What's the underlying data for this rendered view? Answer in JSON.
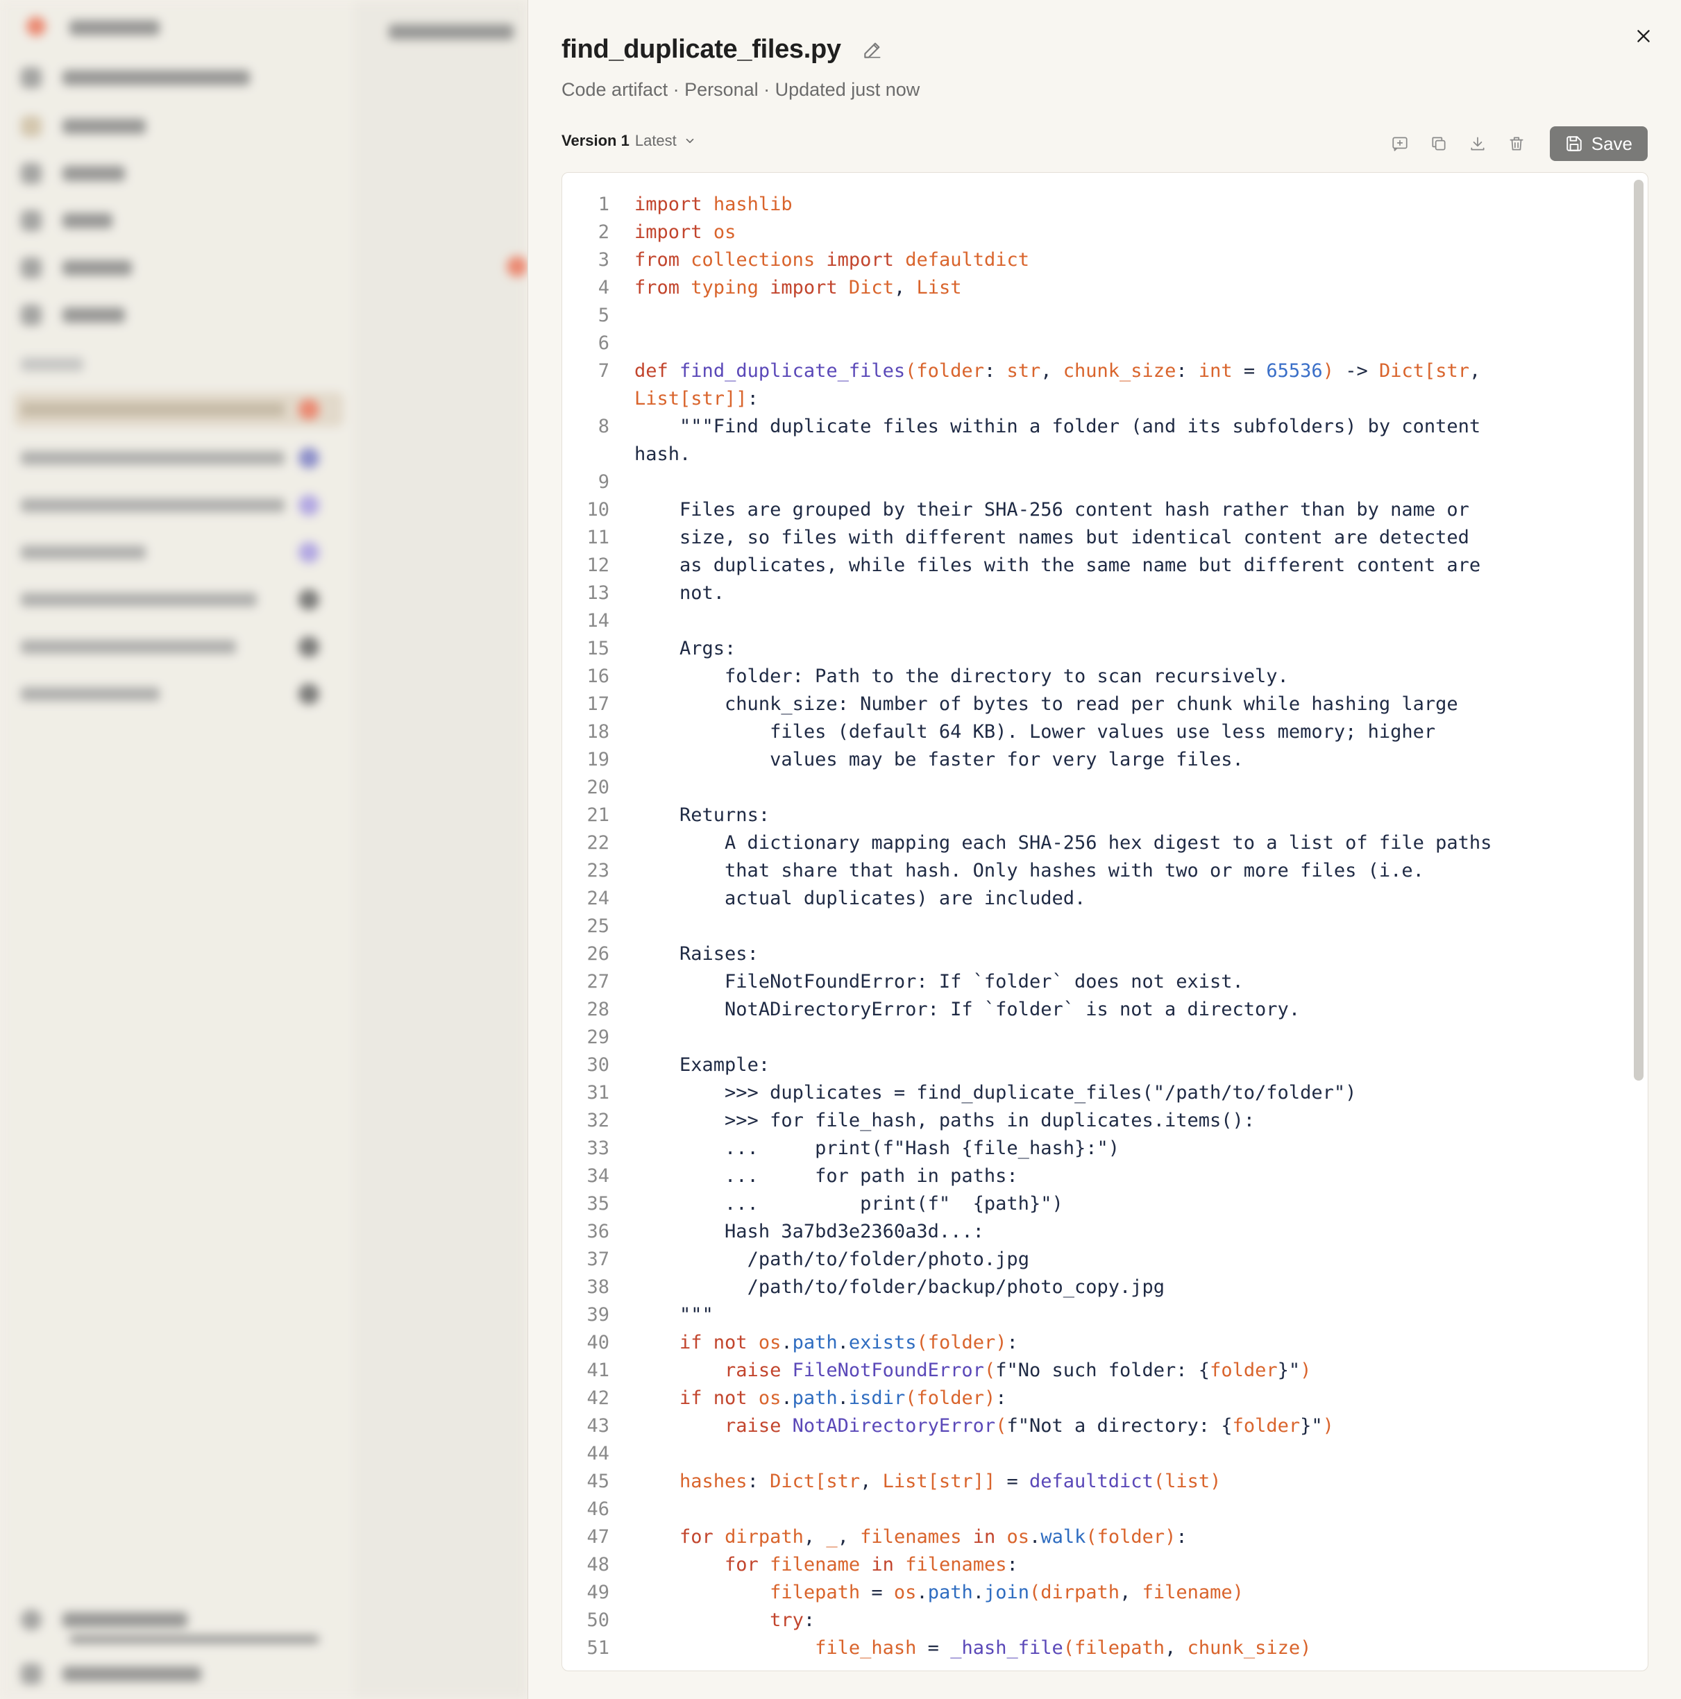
{
  "artifact": {
    "title": "find_duplicate_files.py",
    "subtitle": "Code artifact · Personal · Updated just now",
    "version_name": "Version 1",
    "version_tag": "Latest",
    "save_label": "Save"
  },
  "icons": {
    "edit": "pencil-icon",
    "close": "close-icon",
    "chevron": "chevron-down-icon",
    "comment": "add-comment-icon",
    "copy": "copy-icon",
    "download": "download-icon",
    "delete": "trash-icon",
    "save": "floppy-disk-icon"
  },
  "colors": {
    "keyword": "#c2452d",
    "identifier": "#d9642c",
    "function": "#5a48b8",
    "number": "#3a6fc8",
    "save_button": "#7a7a78"
  },
  "code_lines": [
    {
      "n": "1",
      "t": "<span class=\"kw\">import</span> <span class=\"id\">hashlib</span>"
    },
    {
      "n": "2",
      "t": "<span class=\"kw\">import</span> <span class=\"id\">os</span>"
    },
    {
      "n": "3",
      "t": "<span class=\"kw\">from</span> <span class=\"id\">collections</span> <span class=\"kw\">import</span> <span class=\"id\">defaultdict</span>"
    },
    {
      "n": "4",
      "t": "<span class=\"kw\">from</span> <span class=\"id\">typing</span> <span class=\"kw\">import</span> <span class=\"id\">Dict</span>, <span class=\"id\">List</span>"
    },
    {
      "n": "5",
      "t": ""
    },
    {
      "n": "6",
      "t": ""
    },
    {
      "n": "7",
      "t": "<span class=\"kw\">def</span> <span class=\"fn\">find_duplicate_files</span><span class=\"id\">(folder</span>: <span class=\"id\">str</span>, <span class=\"id\">chunk_size</span>: <span class=\"id\">int</span> = <span class=\"num\">65536</span><span class=\"id\">)</span> -&gt; <span class=\"id\">Dict[str</span>,\n<span class=\"id\">List[str]]</span>:"
    },
    {
      "n": "8",
      "t": "    \"\"\"Find duplicate files within a folder (and its subfolders) by content\nhash."
    },
    {
      "n": "9",
      "t": ""
    },
    {
      "n": "10",
      "t": "    Files are grouped by their SHA-256 content hash rather than by name or"
    },
    {
      "n": "11",
      "t": "    size, so files with different names but identical content are detected"
    },
    {
      "n": "12",
      "t": "    as duplicates, while files with the same name but different content are"
    },
    {
      "n": "13",
      "t": "    not."
    },
    {
      "n": "14",
      "t": ""
    },
    {
      "n": "15",
      "t": "    Args:"
    },
    {
      "n": "16",
      "t": "        folder: Path to the directory to scan recursively."
    },
    {
      "n": "17",
      "t": "        chunk_size: Number of bytes to read per chunk while hashing large"
    },
    {
      "n": "18",
      "t": "            files (default 64 KB). Lower values use less memory; higher"
    },
    {
      "n": "19",
      "t": "            values may be faster for very large files."
    },
    {
      "n": "20",
      "t": ""
    },
    {
      "n": "21",
      "t": "    Returns:"
    },
    {
      "n": "22",
      "t": "        A dictionary mapping each SHA-256 hex digest to a list of file paths"
    },
    {
      "n": "23",
      "t": "        that share that hash. Only hashes with two or more files (i.e."
    },
    {
      "n": "24",
      "t": "        actual duplicates) are included."
    },
    {
      "n": "25",
      "t": ""
    },
    {
      "n": "26",
      "t": "    Raises:"
    },
    {
      "n": "27",
      "t": "        FileNotFoundError: If `folder` does not exist."
    },
    {
      "n": "28",
      "t": "        NotADirectoryError: If `folder` is not a directory."
    },
    {
      "n": "29",
      "t": ""
    },
    {
      "n": "30",
      "t": "    Example:"
    },
    {
      "n": "31",
      "t": "        &gt;&gt;&gt; duplicates = find_duplicate_files(\"/path/to/folder\")"
    },
    {
      "n": "32",
      "t": "        &gt;&gt;&gt; for file_hash, paths in duplicates.items():"
    },
    {
      "n": "33",
      "t": "        ...     print(f\"Hash {file_hash}:\")"
    },
    {
      "n": "34",
      "t": "        ...     for path in paths:"
    },
    {
      "n": "35",
      "t": "        ...         print(f\"  {path}\")"
    },
    {
      "n": "36",
      "t": "        Hash 3a7bd3e2360a3d...:"
    },
    {
      "n": "37",
      "t": "          /path/to/folder/photo.jpg"
    },
    {
      "n": "38",
      "t": "          /path/to/folder/backup/photo_copy.jpg"
    },
    {
      "n": "39",
      "t": "    \"\"\""
    },
    {
      "n": "40",
      "t": "    <span class=\"kw\">if not</span> <span class=\"id\">os</span>.<span class=\"at\">path</span>.<span class=\"at\">exists</span><span class=\"id\">(folder)</span>:"
    },
    {
      "n": "41",
      "t": "        <span class=\"kw\">raise</span> <span class=\"fn\">FileNotFoundError</span><span class=\"id\">(</span>f\"No such folder: {<span class=\"id\">folder</span>}\"<span class=\"id\">)</span>"
    },
    {
      "n": "42",
      "t": "    <span class=\"kw\">if not</span> <span class=\"id\">os</span>.<span class=\"at\">path</span>.<span class=\"at\">isdir</span><span class=\"id\">(folder)</span>:"
    },
    {
      "n": "43",
      "t": "        <span class=\"kw\">raise</span> <span class=\"fn\">NotADirectoryError</span><span class=\"id\">(</span>f\"Not a directory: {<span class=\"id\">folder</span>}\"<span class=\"id\">)</span>"
    },
    {
      "n": "44",
      "t": ""
    },
    {
      "n": "45",
      "t": "    <span class=\"id\">hashes</span>: <span class=\"id\">Dict[str</span>, <span class=\"id\">List[str]]</span> = <span class=\"fn\">defaultdict</span><span class=\"id\">(list)</span>"
    },
    {
      "n": "46",
      "t": ""
    },
    {
      "n": "47",
      "t": "    <span class=\"kw\">for</span> <span class=\"id\">dirpath</span>, <span class=\"id\">_</span>, <span class=\"id\">filenames</span> <span class=\"kw\">in</span> <span class=\"id\">os</span>.<span class=\"at\">walk</span><span class=\"id\">(folder)</span>:"
    },
    {
      "n": "48",
      "t": "        <span class=\"kw\">for</span> <span class=\"id\">filename</span> <span class=\"kw\">in</span> <span class=\"id\">filenames</span>:"
    },
    {
      "n": "49",
      "t": "            <span class=\"id\">filepath</span> = <span class=\"id\">os</span>.<span class=\"at\">path</span>.<span class=\"at\">join</span><span class=\"id\">(dirpath</span>, <span class=\"id\">filename)</span>"
    },
    {
      "n": "50",
      "t": "            <span class=\"kw\">try</span>:"
    },
    {
      "n": "51",
      "t": "                <span class=\"id\">file_hash</span> = <span class=\"fn\">_hash_file</span><span class=\"id\">(filepath</span>, <span class=\"id\">chunk_size)</span>"
    }
  ]
}
